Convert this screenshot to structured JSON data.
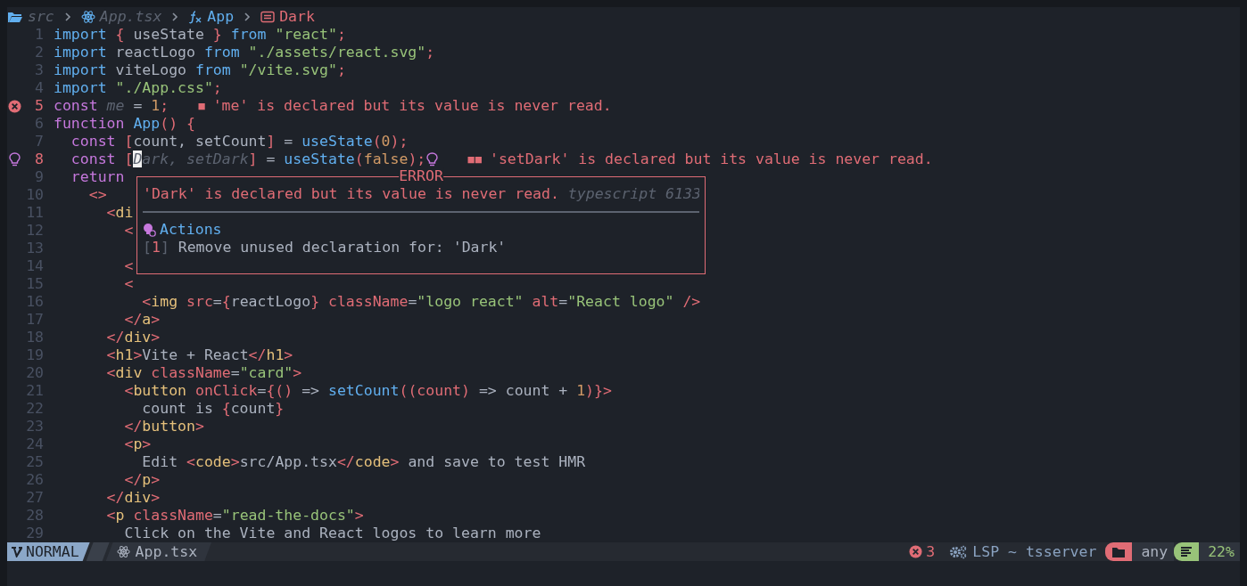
{
  "breadcrumb": [
    {
      "kind": "folder",
      "label": "src"
    },
    {
      "kind": "file",
      "label": "App.tsx"
    },
    {
      "kind": "function",
      "label": "App"
    },
    {
      "kind": "variable",
      "label": "Dark"
    }
  ],
  "lines": [
    {
      "number": "1",
      "tokens": [
        {
          "kind": "kw2",
          "text": "import "
        },
        {
          "kind": "punct",
          "text": "{"
        },
        {
          "kind": "plain",
          "text": " useState "
        },
        {
          "kind": "punct",
          "text": "}"
        },
        {
          "kind": "kw2",
          "text": " from "
        },
        {
          "kind": "str",
          "text": "\"react\""
        },
        {
          "kind": "punct",
          "text": ";"
        }
      ]
    },
    {
      "number": "2",
      "tokens": [
        {
          "kind": "kw2",
          "text": "import "
        },
        {
          "kind": "plain",
          "text": "reactLogo "
        },
        {
          "kind": "kw2",
          "text": "from "
        },
        {
          "kind": "str",
          "text": "\"./assets/react.svg\""
        },
        {
          "kind": "punct",
          "text": ";"
        }
      ]
    },
    {
      "number": "3",
      "tokens": [
        {
          "kind": "kw2",
          "text": "import "
        },
        {
          "kind": "plain",
          "text": "viteLogo "
        },
        {
          "kind": "kw2",
          "text": "from "
        },
        {
          "kind": "str",
          "text": "\"/vite.svg\""
        },
        {
          "kind": "punct",
          "text": ";"
        }
      ]
    },
    {
      "number": "4",
      "tokens": [
        {
          "kind": "kw2",
          "text": "import "
        },
        {
          "kind": "str",
          "text": "\"./App.css\""
        },
        {
          "kind": "punct",
          "text": ";"
        }
      ]
    },
    {
      "number": "5",
      "error_sign": true,
      "tokens": [
        {
          "kind": "kw",
          "text": "const "
        },
        {
          "kind": "unused",
          "text": "me"
        },
        {
          "kind": "plain",
          "text": " = "
        },
        {
          "kind": "num",
          "text": "1"
        },
        {
          "kind": "punct",
          "text": ";"
        }
      ],
      "diagnostic": {
        "markers": "■",
        "message": "'me' is declared but its value is never read."
      }
    },
    {
      "number": "6",
      "tokens": [
        {
          "kind": "kw",
          "text": "function "
        },
        {
          "kind": "fn",
          "text": "App"
        },
        {
          "kind": "punct",
          "text": "() {"
        }
      ]
    },
    {
      "number": "7",
      "tokens": [
        {
          "kind": "kw",
          "text": "  const "
        },
        {
          "kind": "punct",
          "text": "["
        },
        {
          "kind": "plain",
          "text": "count, setCount"
        },
        {
          "kind": "punct",
          "text": "]"
        },
        {
          "kind": "plain",
          "text": " = "
        },
        {
          "kind": "fn",
          "text": "useState"
        },
        {
          "kind": "punct",
          "text": "("
        },
        {
          "kind": "num",
          "text": "0"
        },
        {
          "kind": "punct",
          "text": ");"
        }
      ]
    },
    {
      "number": "8",
      "hint_sign": true,
      "code_action": true,
      "tokens": [
        {
          "kind": "kw",
          "text": "  const "
        },
        {
          "kind": "punct",
          "text": "["
        },
        {
          "kind": "cursor",
          "text": "D"
        },
        {
          "kind": "unused",
          "text": "ark, setDark"
        },
        {
          "kind": "punct",
          "text": "]"
        },
        {
          "kind": "plain",
          "text": " = "
        },
        {
          "kind": "fn",
          "text": "useState"
        },
        {
          "kind": "punct",
          "text": "("
        },
        {
          "kind": "num",
          "text": "false"
        },
        {
          "kind": "punct",
          "text": ");"
        }
      ],
      "diagnostic": {
        "markers": "■■",
        "message": "'setDark' is declared but its value is never read."
      }
    },
    {
      "number": "9",
      "tokens": [
        {
          "kind": "kw",
          "text": "  return"
        }
      ]
    },
    {
      "number": "10",
      "tokens": [
        {
          "kind": "punct",
          "text": "    <>"
        }
      ]
    },
    {
      "number": "11",
      "tokens": [
        {
          "kind": "punct",
          "text": "      <"
        },
        {
          "kind": "tag",
          "text": "di"
        }
      ]
    },
    {
      "number": "12",
      "tokens": [
        {
          "kind": "punct",
          "text": "        <"
        }
      ]
    },
    {
      "number": "13"
    },
    {
      "number": "14",
      "tokens": [
        {
          "kind": "punct",
          "text": "        <"
        }
      ]
    },
    {
      "number": "15",
      "tokens": [
        {
          "kind": "punct",
          "text": "        <"
        }
      ]
    },
    {
      "number": "16",
      "tokens": [
        {
          "kind": "punct",
          "text": "          <"
        },
        {
          "kind": "tag",
          "text": "img"
        },
        {
          "kind": "attr",
          "text": " src"
        },
        {
          "kind": "plain",
          "text": "="
        },
        {
          "kind": "punct",
          "text": "{"
        },
        {
          "kind": "plain",
          "text": "reactLogo"
        },
        {
          "kind": "punct",
          "text": "}"
        },
        {
          "kind": "attr",
          "text": " className"
        },
        {
          "kind": "plain",
          "text": "="
        },
        {
          "kind": "str",
          "text": "\"logo react\""
        },
        {
          "kind": "attr",
          "text": " alt"
        },
        {
          "kind": "plain",
          "text": "="
        },
        {
          "kind": "str",
          "text": "\"React logo\""
        },
        {
          "kind": "punct",
          "text": " />"
        }
      ]
    },
    {
      "number": "17",
      "tokens": [
        {
          "kind": "punct",
          "text": "        </"
        },
        {
          "kind": "tag",
          "text": "a"
        },
        {
          "kind": "punct",
          "text": ">"
        }
      ]
    },
    {
      "number": "18",
      "tokens": [
        {
          "kind": "punct",
          "text": "      </"
        },
        {
          "kind": "tag",
          "text": "div"
        },
        {
          "kind": "punct",
          "text": ">"
        }
      ]
    },
    {
      "number": "19",
      "tokens": [
        {
          "kind": "punct",
          "text": "      <"
        },
        {
          "kind": "tag",
          "text": "h1"
        },
        {
          "kind": "punct",
          "text": ">"
        },
        {
          "kind": "plain",
          "text": "Vite + React"
        },
        {
          "kind": "punct",
          "text": "</"
        },
        {
          "kind": "tag",
          "text": "h1"
        },
        {
          "kind": "punct",
          "text": ">"
        }
      ]
    },
    {
      "number": "20",
      "tokens": [
        {
          "kind": "punct",
          "text": "      <"
        },
        {
          "kind": "tag",
          "text": "div"
        },
        {
          "kind": "attr",
          "text": " className"
        },
        {
          "kind": "plain",
          "text": "="
        },
        {
          "kind": "str",
          "text": "\"card\""
        },
        {
          "kind": "punct",
          "text": ">"
        }
      ]
    },
    {
      "number": "21",
      "tokens": [
        {
          "kind": "punct",
          "text": "        <"
        },
        {
          "kind": "tag",
          "text": "button"
        },
        {
          "kind": "attr",
          "text": " onClick"
        },
        {
          "kind": "plain",
          "text": "="
        },
        {
          "kind": "punct",
          "text": "{() "
        },
        {
          "kind": "plain",
          "text": "=> "
        },
        {
          "kind": "fn",
          "text": "setCount"
        },
        {
          "kind": "punct",
          "text": "((count) "
        },
        {
          "kind": "plain",
          "text": "=> count + "
        },
        {
          "kind": "num",
          "text": "1"
        },
        {
          "kind": "punct",
          "text": ")}>"
        }
      ]
    },
    {
      "number": "22",
      "tokens": [
        {
          "kind": "plain",
          "text": "          count is "
        },
        {
          "kind": "punct",
          "text": "{"
        },
        {
          "kind": "plain",
          "text": "count"
        },
        {
          "kind": "punct",
          "text": "}"
        }
      ]
    },
    {
      "number": "23",
      "tokens": [
        {
          "kind": "punct",
          "text": "        </"
        },
        {
          "kind": "tag",
          "text": "button"
        },
        {
          "kind": "punct",
          "text": ">"
        }
      ]
    },
    {
      "number": "24",
      "tokens": [
        {
          "kind": "punct",
          "text": "        <"
        },
        {
          "kind": "tag",
          "text": "p"
        },
        {
          "kind": "punct",
          "text": ">"
        }
      ]
    },
    {
      "number": "25",
      "tokens": [
        {
          "kind": "plain",
          "text": "          Edit "
        },
        {
          "kind": "punct",
          "text": "<"
        },
        {
          "kind": "tag",
          "text": "code"
        },
        {
          "kind": "punct",
          "text": ">"
        },
        {
          "kind": "plain",
          "text": "src/App.tsx"
        },
        {
          "kind": "punct",
          "text": "</"
        },
        {
          "kind": "tag",
          "text": "code"
        },
        {
          "kind": "punct",
          "text": ">"
        },
        {
          "kind": "plain",
          "text": " and save to test HMR"
        }
      ]
    },
    {
      "number": "26",
      "tokens": [
        {
          "kind": "punct",
          "text": "        </"
        },
        {
          "kind": "tag",
          "text": "p"
        },
        {
          "kind": "punct",
          "text": ">"
        }
      ]
    },
    {
      "number": "27",
      "tokens": [
        {
          "kind": "punct",
          "text": "      </"
        },
        {
          "kind": "tag",
          "text": "div"
        },
        {
          "kind": "punct",
          "text": ">"
        }
      ]
    },
    {
      "number": "28",
      "tokens": [
        {
          "kind": "punct",
          "text": "      <"
        },
        {
          "kind": "tag",
          "text": "p"
        },
        {
          "kind": "attr",
          "text": " className"
        },
        {
          "kind": "plain",
          "text": "="
        },
        {
          "kind": "str",
          "text": "\"read-the-docs\""
        },
        {
          "kind": "punct",
          "text": ">"
        }
      ]
    },
    {
      "number": "29",
      "tokens": [
        {
          "kind": "plain",
          "text": "        Click on the Vite and React logos to learn more"
        }
      ]
    }
  ],
  "popup": {
    "title": "ERROR",
    "message": "'Dark' is declared but its value is never read.",
    "source": "typescript 6133",
    "actions_heading": "Actions",
    "actions": [
      {
        "open": "[",
        "index": "1",
        "close": "]",
        "label": "Remove unused declaration for: 'Dark'"
      }
    ]
  },
  "status_bar": {
    "mode": "NORMAL",
    "file": "App.tsx",
    "errors": "3",
    "lsp": "LSP ~ tsserver",
    "filetype": "any",
    "progress": "22%"
  }
}
